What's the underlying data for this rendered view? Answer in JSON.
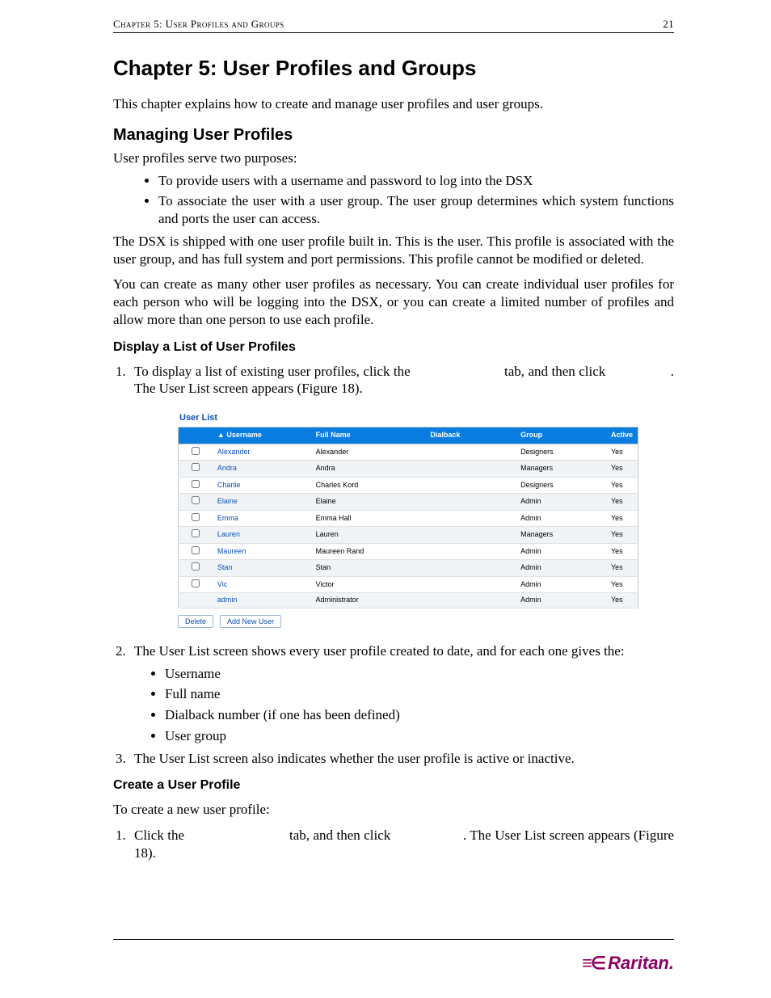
{
  "header": {
    "left": "Chapter 5: User Profiles and Groups",
    "right": "21"
  },
  "h1": "Chapter 5: User Profiles and Groups",
  "intro": "This chapter explains how to create and manage user profiles and user groups.",
  "h2_manage": "Managing User Profiles",
  "p_serve": "User profiles serve two purposes:",
  "bullets_purpose": [
    "To provide users with a username and password to log into the DSX",
    "To associate the user with a user group. The user group determines which system functions and ports the user can access."
  ],
  "p_shipped": "The DSX is shipped with one user profile built in. This is the            user. This profile is associated with the            user group, and has full system and port permissions. This profile cannot be modified or deleted.",
  "p_create_many": "You can create as many other user profiles as necessary. You can create individual user profiles for each person who will be logging into the DSX, or you can create a limited number of profiles and allow more than one person to use each profile.",
  "h3_display": "Display a List of User Profiles",
  "step_display_1a": "To display a list of existing user profiles, click the ",
  "step_display_1b": " tab, and then click ",
  "step_display_1c": ". The User List screen appears (Figure 18).",
  "figure": {
    "title": "User List",
    "headers": {
      "cb": "",
      "username": "▲ Username",
      "fullname": "Full Name",
      "dialback": "Dialback",
      "group": "Group",
      "active": "Active"
    },
    "rows": [
      {
        "u": "Alexander",
        "f": "Alexander",
        "d": "",
        "g": "Designers",
        "a": "Yes",
        "cb": true
      },
      {
        "u": "Andra",
        "f": "Andra",
        "d": "",
        "g": "Managers",
        "a": "Yes",
        "cb": true
      },
      {
        "u": "Charlie",
        "f": "Charles Kord",
        "d": "",
        "g": "Designers",
        "a": "Yes",
        "cb": true
      },
      {
        "u": "Elaine",
        "f": "Elaine",
        "d": "",
        "g": "Admin",
        "a": "Yes",
        "cb": true
      },
      {
        "u": "Emma",
        "f": "Emma Hall",
        "d": "",
        "g": "Admin",
        "a": "Yes",
        "cb": true
      },
      {
        "u": "Lauren",
        "f": "Lauren",
        "d": "",
        "g": "Managers",
        "a": "Yes",
        "cb": true
      },
      {
        "u": "Maureen",
        "f": "Maureen Rand",
        "d": "",
        "g": "Admin",
        "a": "Yes",
        "cb": true
      },
      {
        "u": "Stan",
        "f": "Stan",
        "d": "",
        "g": "Admin",
        "a": "Yes",
        "cb": true
      },
      {
        "u": "Vic",
        "f": "Victor",
        "d": "",
        "g": "Admin",
        "a": "Yes",
        "cb": true
      },
      {
        "u": "admin",
        "f": "Administrator",
        "d": "",
        "g": "Admin",
        "a": "Yes",
        "cb": false
      }
    ],
    "buttons": {
      "delete": "Delete",
      "add": "Add New User"
    }
  },
  "step_display_2": "The User List screen shows every user profile created to date, and for each one gives the:",
  "bullets_fields": [
    "Username",
    "Full name",
    "Dialback number (if one has been defined)",
    "User group"
  ],
  "step_display_3": "The User List screen also indicates whether the user profile is active or inactive.",
  "h3_create": "Create a User Profile",
  "p_tocreate": "To create a new user profile:",
  "step_create_1a": "Click the ",
  "step_create_1b": " tab, and then click ",
  "step_create_1c": ". The User List screen appears (Figure 18).",
  "footer_logo": "Raritan."
}
